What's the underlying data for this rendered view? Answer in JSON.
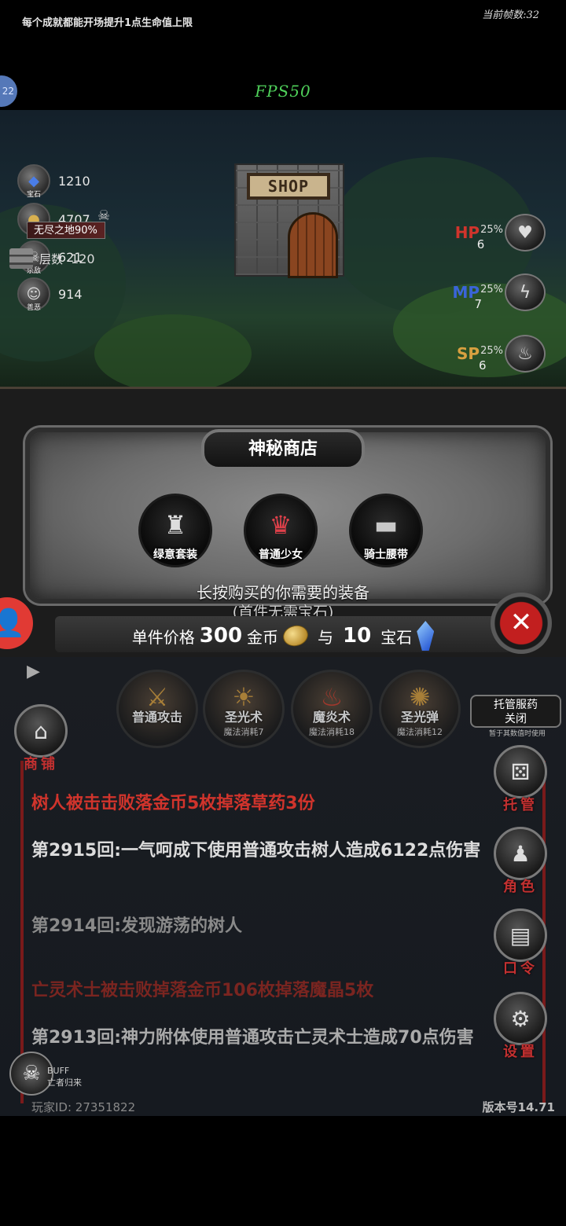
{
  "fps": "FPS50",
  "tip": "每个成就都能开场提升1点生命值上限",
  "frame_count": "当前帧数:32",
  "side_badge": "22",
  "resources": [
    {
      "icon": "gem-icon",
      "sub": "宝石",
      "value": "1210"
    },
    {
      "icon": "coin-icon",
      "sub": "金币",
      "value": "4707"
    },
    {
      "icon": "skull-icon",
      "sub": "杀敌",
      "value": "621"
    },
    {
      "icon": "mask-icon",
      "sub": "善恶",
      "value": "914"
    }
  ],
  "land": "无尽之地90%",
  "floor_label": "层数",
  "floor_value": "120",
  "stats": [
    {
      "label": "HP",
      "pct": "25%",
      "count": "6",
      "color": "#d0342c"
    },
    {
      "label": "MP",
      "pct": "25%",
      "count": "7",
      "color": "#3a64d8"
    },
    {
      "label": "SP",
      "pct": "25%",
      "count": "6",
      "color": "#d8a040"
    }
  ],
  "shop_sign": "SHOP",
  "shop_panel": {
    "title": "神秘商店",
    "items": [
      {
        "name": "绿意套装",
        "icon": "armor-icon"
      },
      {
        "name": "普通少女",
        "icon": "girl-icon"
      },
      {
        "name": "骑士腰带",
        "icon": "belt-icon"
      }
    ],
    "hint": "长按购买的你需要的装备",
    "hint_sub": "(首件无需宝石)",
    "price_prefix": "单件价格",
    "gold_amount": "300",
    "gold_unit": "金币",
    "and": "与",
    "gem_amount": "10",
    "gem_unit": "宝石"
  },
  "skills": [
    {
      "name": "普通攻击",
      "cost": ""
    },
    {
      "name": "圣光术",
      "cost": "魔法消耗7"
    },
    {
      "name": "魔炎术",
      "cost": "魔法消耗18"
    },
    {
      "name": "圣光弹",
      "cost": "魔法消耗12"
    }
  ],
  "auto_drug": {
    "line1": "托管服药",
    "line2": "关闭",
    "sub": "暂于其数值时使用"
  },
  "shop_button": "商铺",
  "side_buttons": [
    {
      "label": "托管",
      "icon": "dice-icon"
    },
    {
      "label": "角色",
      "icon": "hooded-figure-icon"
    },
    {
      "label": "口令",
      "icon": "book-icon"
    },
    {
      "label": "设置",
      "icon": "gear-icon"
    }
  ],
  "log": [
    "树人被击击败落金币5枚掉落草药3份",
    "第2915回:一气呵成下使用普通攻击树人造成6122点伤害",
    "第2914回:发现游荡的树人",
    "亡灵术士被击败掉落金币106枚掉落魔晶5枚",
    "第2913回:神力附体使用普通攻击亡灵术士造成70点伤害"
  ],
  "buff": {
    "line1": "BUFF",
    "line2": "亡者归来"
  },
  "player_id": "玩家ID:  27351822",
  "version": "版本号14.71"
}
